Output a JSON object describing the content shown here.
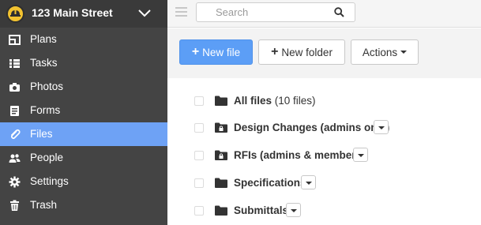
{
  "project": {
    "name": "123 Main Street",
    "logo_icon": "hardhat-logo-icon",
    "chevron_icon": "chevron-down-icon"
  },
  "sidebar": {
    "items": [
      {
        "label": "Plans",
        "icon": "plans-icon",
        "active": false
      },
      {
        "label": "Tasks",
        "icon": "tasks-icon",
        "active": false
      },
      {
        "label": "Photos",
        "icon": "camera-icon",
        "active": false
      },
      {
        "label": "Forms",
        "icon": "forms-icon",
        "active": false
      },
      {
        "label": "Files",
        "icon": "paperclip-icon",
        "active": true
      },
      {
        "label": "People",
        "icon": "people-icon",
        "active": false
      },
      {
        "label": "Settings",
        "icon": "gear-icon",
        "active": false
      },
      {
        "label": "Trash",
        "icon": "trash-icon",
        "active": false
      }
    ],
    "active_color": "#6ea2f5",
    "background_color": "#444444"
  },
  "topbar": {
    "menu_icon": "hamburger-icon",
    "search": {
      "placeholder": "Search",
      "value": "",
      "icon": "search-icon"
    }
  },
  "toolbar": {
    "new_file_label": "New file",
    "new_folder_label": "New folder",
    "actions_label": "Actions",
    "primary_color": "#5c9ef6"
  },
  "files": [
    {
      "name": "All files",
      "count": "(10 files)",
      "locked": false,
      "has_dropdown": false
    },
    {
      "name": "Design Changes (admins only)",
      "count": "",
      "locked": true,
      "has_dropdown": true
    },
    {
      "name": "RFIs (admins & members)",
      "count": "",
      "locked": true,
      "has_dropdown": true
    },
    {
      "name": "Specifications",
      "count": "",
      "locked": false,
      "has_dropdown": true
    },
    {
      "name": "Submittals",
      "count": "",
      "locked": false,
      "has_dropdown": true
    }
  ]
}
